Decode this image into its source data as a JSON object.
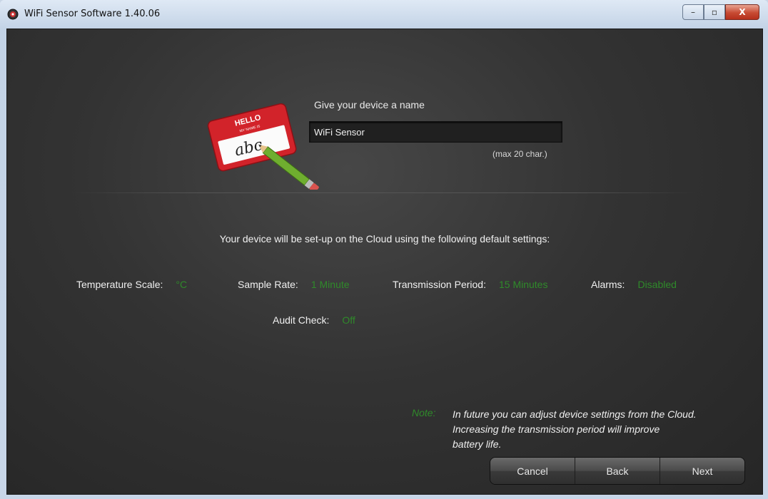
{
  "window": {
    "title": "WiFi Sensor Software 1.40.06",
    "controls": {
      "minimize": "–",
      "maximize": "▫",
      "close": "X"
    }
  },
  "name_section": {
    "tag_hello": "HELLO",
    "tag_subtitle": "MY NAME IS",
    "tag_text": "abc",
    "label": "Give your device a name",
    "input_value": "WiFi Sensor",
    "hint": "(max 20 char.)"
  },
  "setup_text": "Your device will be set-up on the Cloud using the following default settings:",
  "settings": {
    "temperature_scale": {
      "label": "Temperature Scale:",
      "value": "°C"
    },
    "sample_rate": {
      "label": "Sample Rate:",
      "value": "1 Minute"
    },
    "transmission_period": {
      "label": "Transmission Period:",
      "value": "15 Minutes"
    },
    "alarms": {
      "label": "Alarms:",
      "value": "Disabled"
    },
    "audit_check": {
      "label": "Audit Check:",
      "value": "Off"
    }
  },
  "note": {
    "label": "Note:",
    "lines": [
      "In future you can adjust device settings from the Cloud.",
      "Increasing the transmission period will improve",
      "battery life."
    ]
  },
  "buttons": {
    "cancel": "Cancel",
    "back": "Back",
    "next": "Next"
  },
  "colors": {
    "accent_green": "#2f8a2a",
    "background": "#333333"
  }
}
